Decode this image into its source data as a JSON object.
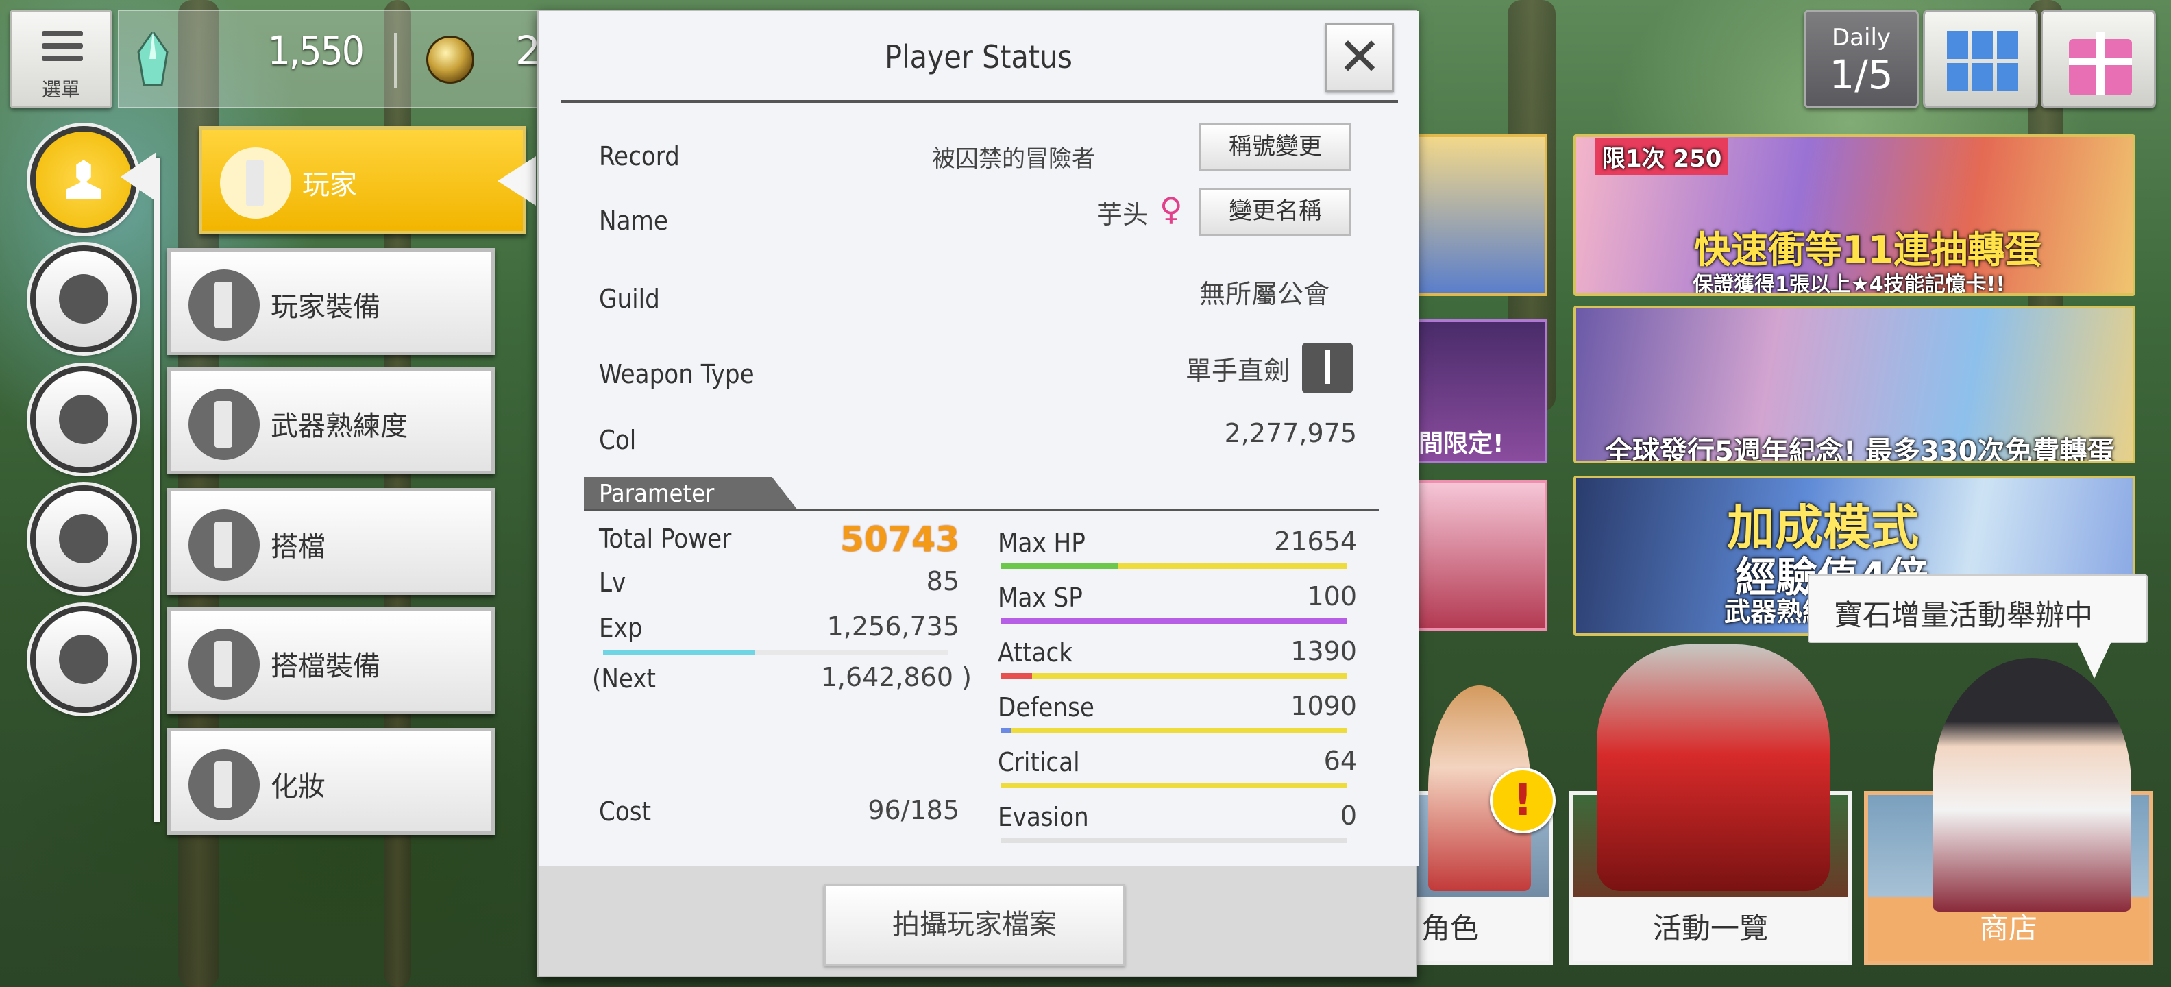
{
  "top_bar": {
    "menu_label": "選單",
    "gem_value": "1,550",
    "col_value": "2,",
    "daily_label": "Daily",
    "daily_value": "1/5"
  },
  "sidebar": {
    "items": [
      {
        "label": "玩家"
      },
      {
        "label": "玩家裝備"
      },
      {
        "label": "武器熟練度"
      },
      {
        "label": "搭檔"
      },
      {
        "label": "搭檔裝備"
      },
      {
        "label": "化妝"
      }
    ]
  },
  "dialog": {
    "title": "Player Status",
    "close_glyph": "✕",
    "record_label": "Record",
    "record_value": "被囚禁的冒險者",
    "record_button": "稱號變更",
    "name_label": "Name",
    "name_value": "芋头",
    "gender_glyph": "♀",
    "name_button": "變更名稱",
    "guild_label": "Guild",
    "guild_value": "無所屬公會",
    "weapon_label": "Weapon Type",
    "weapon_value": "單手直劍",
    "col_label": "Col",
    "col_value": "2,277,975",
    "parameter_header": "Parameter",
    "left_params": {
      "total_power_label": "Total Power",
      "total_power_value": "50743",
      "lv_label": "Lv",
      "lv_value": "85",
      "exp_label": "Exp",
      "exp_value": "1,256,735",
      "exp_progress": 0.44,
      "next_label": "(Next",
      "next_value": "1,642,860 )",
      "cost_label": "Cost",
      "cost_value": "96/185"
    },
    "right_params": [
      {
        "label": "Max HP",
        "value": "21654",
        "fill": 0.34,
        "fill_color": "#6cc84a",
        "base_color": "#eddc3c"
      },
      {
        "label": "Max SP",
        "value": "100",
        "fill": 1.0,
        "fill_color": "#b75ee6",
        "base_color": "#b75ee6"
      },
      {
        "label": "Attack",
        "value": "1390",
        "fill": 0.09,
        "fill_color": "#e85050",
        "base_color": "#eddc3c"
      },
      {
        "label": "Defense",
        "value": "1090",
        "fill": 0.03,
        "fill_color": "#6a8ae6",
        "base_color": "#eddc3c"
      },
      {
        "label": "Critical",
        "value": "64",
        "fill": 0.0,
        "fill_color": "#eddc3c",
        "base_color": "#eddc3c"
      },
      {
        "label": "Evasion",
        "value": "0",
        "fill": 0.0,
        "fill_color": "#e0e0e0",
        "base_color": "#e0e0e0"
      }
    ],
    "footer_button": "拍攝玩家檔案"
  },
  "banners": {
    "b1_badge": "限1次 250",
    "b1_title": "快速衝等11連抽轉蛋",
    "b1_sub": "保證獲得1張以上★4技能記憶卡!!",
    "b2_title": "全球發行5週年紀念! 最多330次免費轉蛋",
    "b3_title": "加成模式",
    "b3_sub": "經驗值4倍",
    "b3_small": "武器熟練",
    "partial_text": "間限定!"
  },
  "tooltip": "寶石增量活動舉辦中",
  "bottom_cards": {
    "character": "角色",
    "events": "活動一覽",
    "shop": "商店",
    "alert_glyph": "!"
  },
  "colors": {
    "accent_yellow": "#f2b500",
    "power_orange": "#f39a18",
    "shop_orange": "#f2ad6a"
  }
}
